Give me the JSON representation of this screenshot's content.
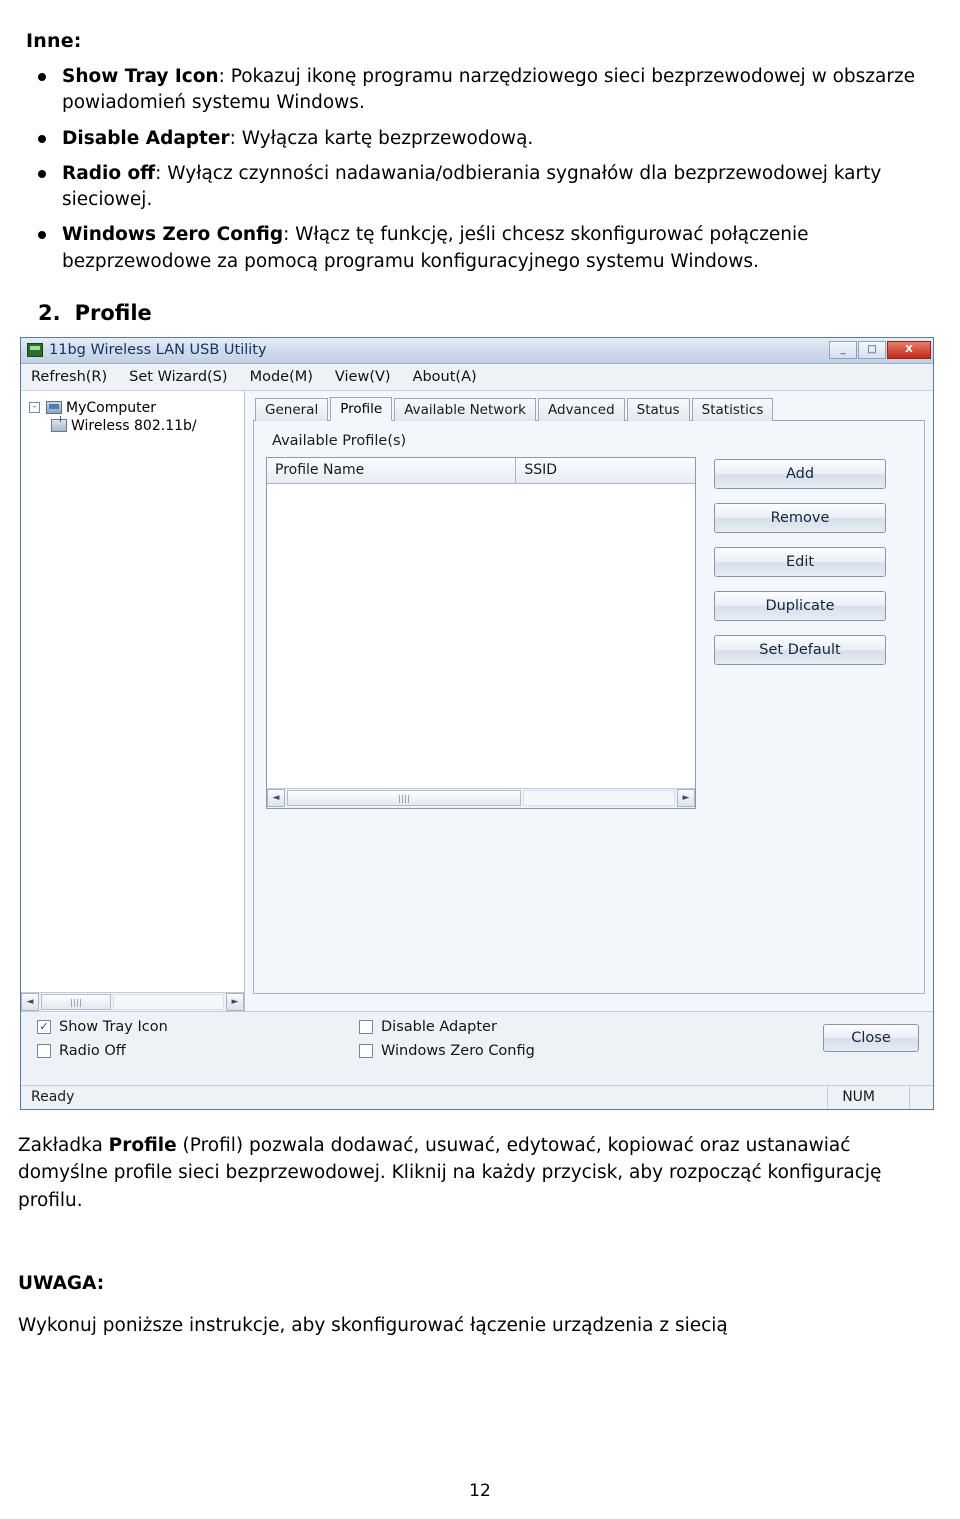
{
  "doc": {
    "section_other_heading": "Inne:",
    "bullets": [
      {
        "bold": "Show Tray Icon",
        "text": ": Pokazuj ikonę programu narzędziowego sieci bezprzewodowej w obszarze powiadomień systemu Windows."
      },
      {
        "bold": "Disable Adapter",
        "text": ": Wyłącza kartę bezprzewodową."
      },
      {
        "bold": "Radio off",
        "text": ": Wyłącz czynności nadawania/odbierania sygnałów dla bezprzewodowej karty sieciowej."
      },
      {
        "bold": "Windows Zero Config",
        "text": ": Włącz tę funkcję, jeśli chcesz skonfigurować połączenie bezprzewodowe za pomocą programu konfiguracyjnego systemu Windows."
      }
    ],
    "section_number": "2.",
    "section_title": "Profile",
    "paragraph_after": "Zakładka Profile (Profil) pozwala dodawać, usuwać, edytować, kopiować oraz ustanawiać domyślne profile sieci bezprzewodowej. Kliknij na każdy przycisk, aby rozpocząć konfigurację profilu.",
    "paragraph_after_bold": "Profile",
    "note_heading": "UWAGA:",
    "note_text": "Wykonuj poniższe instrukcje, aby skonfigurować łączenie urządzenia z siecią",
    "page_number": "12"
  },
  "app": {
    "window_title": "11bg Wireless LAN USB Utility",
    "titlebar_icon": "wireless-adapter-icon",
    "window_buttons": {
      "minimize": "_",
      "maximize": "□",
      "close": "X"
    },
    "menu": [
      "Refresh(R)",
      "Set Wizard(S)",
      "Mode(M)",
      "View(V)",
      "About(A)"
    ],
    "tree": {
      "root": "MyComputer",
      "root_expander": "-",
      "child": "Wireless 802.11b/"
    },
    "tabs": [
      {
        "label": "General",
        "active": false
      },
      {
        "label": "Profile",
        "active": true
      },
      {
        "label": "Available Network",
        "active": false
      },
      {
        "label": "Advanced",
        "active": false
      },
      {
        "label": "Status",
        "active": false
      },
      {
        "label": "Statistics",
        "active": false
      }
    ],
    "panel": {
      "label": "Available Profile(s)",
      "columns": [
        "Profile Name",
        "SSID"
      ],
      "rows": [],
      "buttons": [
        "Add",
        "Remove",
        "Edit",
        "Duplicate",
        "Set Default"
      ]
    },
    "checkboxes": [
      {
        "label": "Show Tray Icon",
        "checked": true,
        "mark": "✓"
      },
      {
        "label": "Radio Off",
        "checked": false,
        "mark": ""
      },
      {
        "label": "Disable Adapter",
        "checked": false,
        "mark": ""
      },
      {
        "label": "Windows Zero Config",
        "checked": false,
        "mark": ""
      }
    ],
    "close_button": "Close",
    "status": {
      "left": "Ready",
      "num": "NUM"
    }
  },
  "colors": {
    "title_text": "#15335c",
    "close_button_red": "#c02a19",
    "panel_bg": "#f3f6fa"
  }
}
